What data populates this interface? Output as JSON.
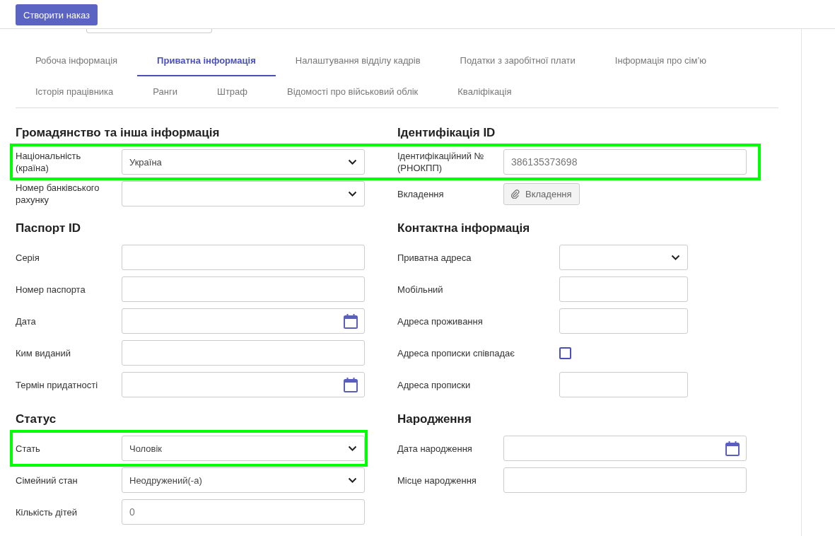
{
  "top_bar": {
    "create_button": "Створити наказ"
  },
  "tab_rows": [
    {
      "tabs": [
        {
          "label": "Робоча інформація",
          "selected": false
        },
        {
          "label": "Приватна інформація",
          "selected": true
        },
        {
          "label": "Налаштування відділу кадрів",
          "selected": false
        },
        {
          "label": "Податки з заробітної плати",
          "selected": false
        },
        {
          "label": "Інформація про сім’ю",
          "selected": false
        }
      ]
    },
    {
      "tabs": [
        {
          "label": "Історія працівника",
          "selected": false
        },
        {
          "label": "Ранги",
          "selected": false
        },
        {
          "label": "Штраф",
          "selected": false
        },
        {
          "label": "Відомості про військовий облік",
          "selected": false
        },
        {
          "label": "Кваліфікація",
          "selected": false
        }
      ]
    }
  ],
  "sections": [
    {
      "title": "Громадянство та інша інформація",
      "fields": [
        {
          "kind": "select",
          "label": "Національність (країна)",
          "value": "Україна",
          "highlighted": true
        },
        {
          "kind": "select",
          "label": "Номер банківського рахунку"
        }
      ]
    },
    {
      "title": "Ідентифікація ID",
      "fields": [
        {
          "kind": "text",
          "label": "Ідентифікаційний № (РНОКПП)",
          "value": "386135373698",
          "highlighted": true
        },
        {
          "kind": "attachment",
          "label": "Вкладення",
          "value": "Вкладення"
        }
      ]
    },
    {
      "title": "Паспорт ID",
      "fields": [
        {
          "kind": "text",
          "label": "Серія"
        },
        {
          "kind": "text",
          "label": "Номер паспорта"
        },
        {
          "kind": "date",
          "label": "Дата"
        },
        {
          "kind": "text",
          "label": "Ким виданий"
        },
        {
          "kind": "date",
          "label": "Термін придатності"
        }
      ]
    },
    {
      "title": "Контактна інформація",
      "fields": [
        {
          "kind": "select",
          "label": "Приватна адреса"
        },
        {
          "kind": "text",
          "label": "Мобільний"
        },
        {
          "kind": "text",
          "label": "Адреса проживання"
        },
        {
          "kind": "checkbox",
          "label": "Адреса прописки співпадає",
          "checked": false
        },
        {
          "kind": "text",
          "label": "Адреса прописки"
        }
      ]
    },
    {
      "title": "Статус",
      "fields": [
        {
          "kind": "select",
          "label": "Стать",
          "value": "Чоловік",
          "highlighted": true
        },
        {
          "kind": "select",
          "label": "Сімейний стан",
          "value": "Неодружений(-а)"
        },
        {
          "kind": "text",
          "label": "Кількість дітей",
          "value": "0"
        }
      ]
    },
    {
      "title": "Народження",
      "fields": [
        {
          "kind": "date",
          "label": "Дата народження"
        },
        {
          "kind": "text",
          "label": "Місце народження"
        }
      ]
    }
  ]
}
